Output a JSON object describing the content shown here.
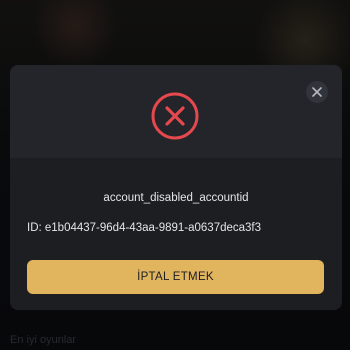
{
  "background": {
    "section_label": "En iyi oyunlar"
  },
  "modal": {
    "message": "account_disabled_accountid",
    "id_text": "ID: e1b04437-96d4-43aa-9891-a0637deca3f3",
    "cancel_label": "İPTAL ETMEK",
    "error_icon": "error-x-circle-icon",
    "close_icon": "close-icon",
    "colors": {
      "accent": "#e1b45e",
      "error": "#e5484d"
    }
  }
}
